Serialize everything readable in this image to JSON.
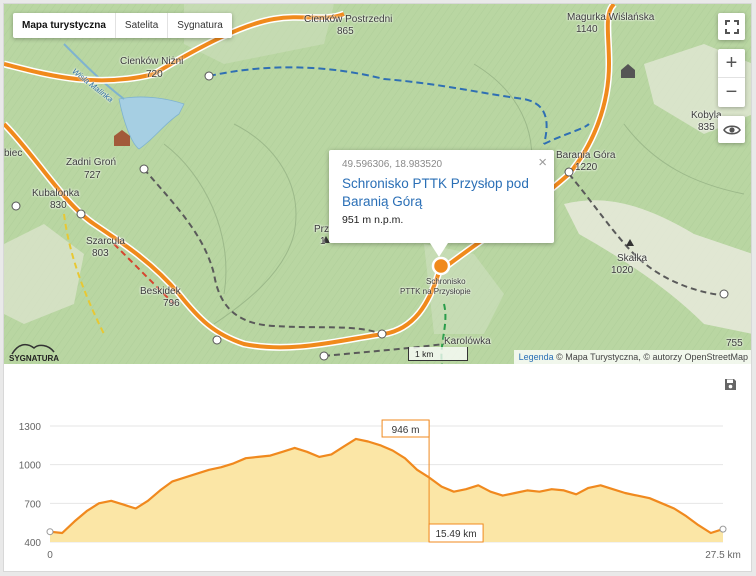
{
  "map": {
    "type_tabs": [
      {
        "label": "Mapa turystyczna",
        "active": true
      },
      {
        "label": "Satelita",
        "active": false
      },
      {
        "label": "Sygnatura",
        "active": false
      }
    ],
    "labels": {
      "cienkow_wyzni_top": "Cienków Postrzedni",
      "elev_865": "865",
      "magurka": "Magurka Wiślańska",
      "elev_1140": "1140",
      "cienkow_nizni": "Cienków Niżni",
      "elev_720": "720",
      "wisla": "Wisła Malinka",
      "zadni_gron": "Zadni Groń",
      "elev_727": "727",
      "kubalonka": "Kubalonka",
      "elev_830": "830",
      "szarcula": "Szarcula",
      "elev_803": "803",
      "beskidek": "Beskidek",
      "elev_796": "796",
      "baranja_gora": "Barania Góra",
      "elev_1220": "1220",
      "kobyla": "Kobyla",
      "elev_835": "835",
      "skalka": "Skałka",
      "elev_1020": "1020",
      "elev_755": "755",
      "schronisko_small": "Schronisko",
      "schronisko_small2": "PTTK na Przysłopie",
      "karolowka": "Karolówka",
      "przyslop": "Przy",
      "elev_1": "1",
      "brzegi": "biec",
      "kobyla_pre": "Kobyl"
    },
    "popup": {
      "coords": "49.596306, 18.983520",
      "title": "Schronisko PTTK Przysłop pod Baranią Górą",
      "elevation": "951 m n.p.m.",
      "close": "×"
    },
    "scale_label": "1 km",
    "attribution": {
      "link": "Legenda",
      "text": " © Mapa Turystyczna, © autorzy OpenStreetMap"
    },
    "logo_text": "SYGNATURA",
    "zoom_in": "+",
    "zoom_out": "−"
  },
  "profile": {
    "cursor_elevation": "946 m",
    "cursor_distance": "15.49 km"
  },
  "chart_data": {
    "type": "area",
    "x_unit": "km",
    "y_unit": "m",
    "ylim": [
      400,
      1300
    ],
    "xlim": [
      0,
      27.5
    ],
    "yticks": [
      400,
      700,
      1000,
      1300
    ],
    "ytick_labels": [
      "400",
      "700",
      "1000",
      "1300"
    ],
    "xtick_labels": [
      "0",
      "27.5 km"
    ],
    "grid": true,
    "line_color": "#f0891e",
    "fill_color": "#fbe6a6",
    "cursor": {
      "x": 15.49,
      "y": 946
    },
    "x": [
      0,
      0.5,
      1,
      1.5,
      2,
      2.5,
      3,
      3.5,
      4,
      4.5,
      5,
      5.5,
      6,
      6.5,
      7,
      7.5,
      8,
      8.5,
      9,
      9.5,
      10,
      10.5,
      11,
      11.5,
      12,
      12.5,
      13,
      13.5,
      14,
      14.5,
      15,
      15.5,
      16,
      16.5,
      17,
      17.5,
      18,
      18.5,
      19,
      19.5,
      20,
      20.5,
      21,
      21.5,
      22,
      22.5,
      23,
      23.5,
      24,
      24.5,
      25,
      25.5,
      26,
      26.5,
      27,
      27.5
    ],
    "y": [
      480,
      470,
      560,
      640,
      700,
      720,
      690,
      660,
      720,
      800,
      870,
      900,
      930,
      960,
      980,
      1010,
      1050,
      1060,
      1070,
      1100,
      1130,
      1100,
      1060,
      1080,
      1140,
      1200,
      1180,
      1150,
      1110,
      1050,
      960,
      900,
      830,
      790,
      810,
      840,
      790,
      760,
      780,
      800,
      790,
      810,
      800,
      770,
      820,
      840,
      810,
      780,
      760,
      740,
      700,
      660,
      600,
      530,
      470,
      500
    ]
  }
}
